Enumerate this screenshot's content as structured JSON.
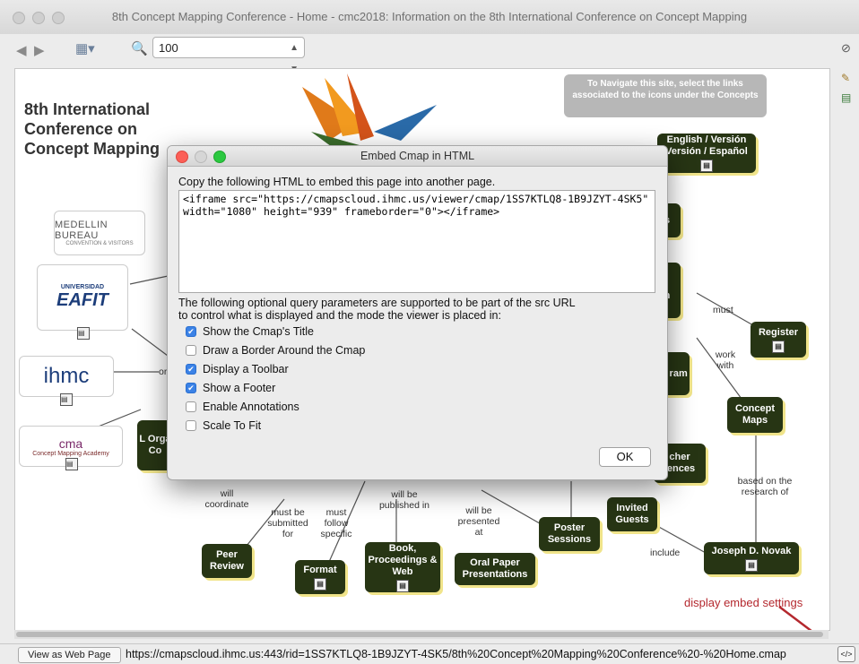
{
  "window": {
    "title": "8th Concept Mapping Conference - Home - cmc2018: Information on the 8th International Conference on Concept Mapping"
  },
  "toolbar": {
    "zoom_value": "100"
  },
  "cmap": {
    "conference_title": "8th International Conference on Concept Mapping",
    "nav_note": "To Navigate this site, select the links associated to the icons under the Concepts",
    "nodes": {
      "english": "English / Versión Versión / Español",
      "register": "Register",
      "concept_maps": "Concept Maps",
      "joseph_novak": "Joseph D. Novak",
      "invited_guests": "Invited Guests",
      "poster_sessions": "Poster Sessions",
      "oral_paper": "Oral Paper Presentations",
      "book": "Book, Proceedings & Web",
      "format": "Format",
      "peer_review": "Peer Review",
      "teacher": "cher iences",
      "social": "ial ram",
      "s_partial": "s",
      "n_partial": "n",
      "comma_partial": ",",
      "left_org": "L Orga Co"
    },
    "links": {
      "must": "must",
      "work_with": "work with",
      "based_on": "based on the research of",
      "include": "include",
      "will_coordinate": "will coordinate",
      "must_be_submitted_for": "must be submitted for",
      "must_follow_specific": "must follow specific",
      "will_be_published_in": "will be published in",
      "will_be_presented_at": "will be presented at",
      "or": "or"
    },
    "logos": {
      "medellin": "MEDELLIN BUREAU",
      "medellin_sub": "CONVENTION & VISITORS",
      "eafit_top": "UNIVERSIDAD",
      "eafit": "EAFIT",
      "ihmc": "ihmc",
      "cma": "Concept Mapping Academy",
      "cma_mark": "cma"
    },
    "embed_note": "display embed settings"
  },
  "dialog": {
    "title": "Embed Cmap in HTML",
    "instruction": "Copy the following HTML to embed this page into another page.",
    "code": "<iframe src=\"https://cmapscloud.ihmc.us/viewer/cmap/1SS7KTLQ8-1B9JZYT-4SK5\"\nwidth=\"1080\" height=\"939\" frameborder=\"0\"></iframe>",
    "params_line1": "The following optional query parameters are supported to be part of the src URL",
    "params_line2": "to control what is displayed and the mode the viewer is placed in:",
    "options": [
      {
        "label": "Show the Cmap's Title",
        "checked": true
      },
      {
        "label": "Draw a Border Around the Cmap",
        "checked": false
      },
      {
        "label": "Display a Toolbar",
        "checked": true
      },
      {
        "label": "Show a Footer",
        "checked": true
      },
      {
        "label": "Enable Annotations",
        "checked": false
      },
      {
        "label": "Scale To Fit",
        "checked": false
      }
    ],
    "ok_label": "OK"
  },
  "status": {
    "view_button": "View as Web Page",
    "url": "https://cmapscloud.ihmc.us:443/rid=1SS7KTLQ8-1B9JZYT-4SK5/8th%20Concept%20Mapping%20Conference%20-%20Home.cmap"
  },
  "colors": {
    "node_bg": "#273514",
    "node_shadow": "#f0e48a",
    "checkbox_on": "#3b82e6",
    "note_red": "#b4282e"
  }
}
